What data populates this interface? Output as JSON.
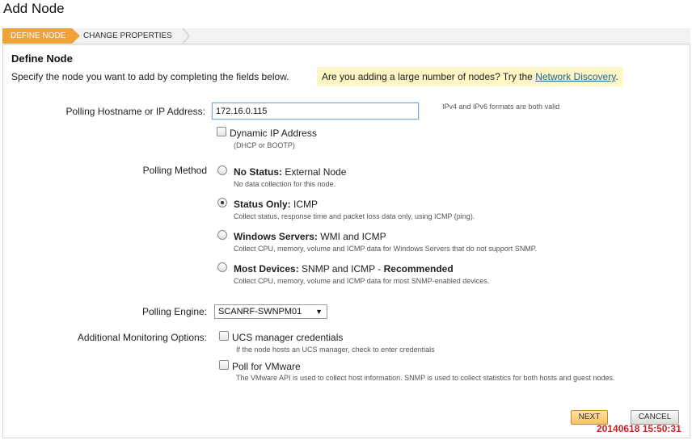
{
  "page": {
    "title": "Add Node"
  },
  "wizard": {
    "steps": [
      "DEFINE NODE",
      "CHANGE PROPERTIES"
    ]
  },
  "section": {
    "title": "Define Node",
    "intro": "Specify the node you want to add by completing the fields below.",
    "hint": {
      "text": "Are you adding a large number of nodes? Try the",
      "link": "Network Discovery",
      "suffix": "."
    }
  },
  "hostname": {
    "label": "Polling Hostname or IP Address:",
    "value": "172.16.0.115",
    "format_note": "IPv4 and IPv6 formats are both valid"
  },
  "dynamic_ip": {
    "label": "Dynamic IP Address",
    "note": "(DHCP or BOOTP)",
    "checked": false
  },
  "polling_method": {
    "label": "Polling Method",
    "options": [
      {
        "title_bold": "No Status:",
        "title_rest": " External Node",
        "desc": "No data collection for this node.",
        "selected": false
      },
      {
        "title_bold": "Status Only:",
        "title_rest": " ICMP",
        "desc": "Collect status, response time and packet loss data only, using ICMP (ping).",
        "selected": true
      },
      {
        "title_bold": "Windows Servers:",
        "title_rest": " WMI and ICMP",
        "desc": "Collect CPU, memory, volume and ICMP data for Windows Servers that do not support SNMP.",
        "selected": false
      },
      {
        "title_bold": "Most Devices:",
        "title_rest": " SNMP and ICMP - ",
        "title_bold2": "Recommended",
        "desc": "Collect CPU, memory, volume and ICMP data for most SNMP-enabled devices.",
        "selected": false
      }
    ]
  },
  "polling_engine": {
    "label": "Polling Engine:",
    "value": "SCANRF-SWNPM01"
  },
  "additional": {
    "label": "Additional Monitoring Options:",
    "options": [
      {
        "label": "UCS manager credentials",
        "note": "If the node hosts an UCS manager, check to enter credentials",
        "checked": false
      },
      {
        "label": "Poll for VMware",
        "note": "The VMware API is used to collect host information. SNMP is used to collect statistics for both hosts and guest nodes.",
        "checked": false
      }
    ]
  },
  "buttons": {
    "next": "NEXT",
    "cancel": "CANCEL"
  },
  "timestamp": "20140618  15:50:31",
  "colors": {
    "accent": "#f0a238",
    "hint_bg": "#fdf6c6",
    "link": "#1a6699",
    "stamp": "#d02020"
  }
}
